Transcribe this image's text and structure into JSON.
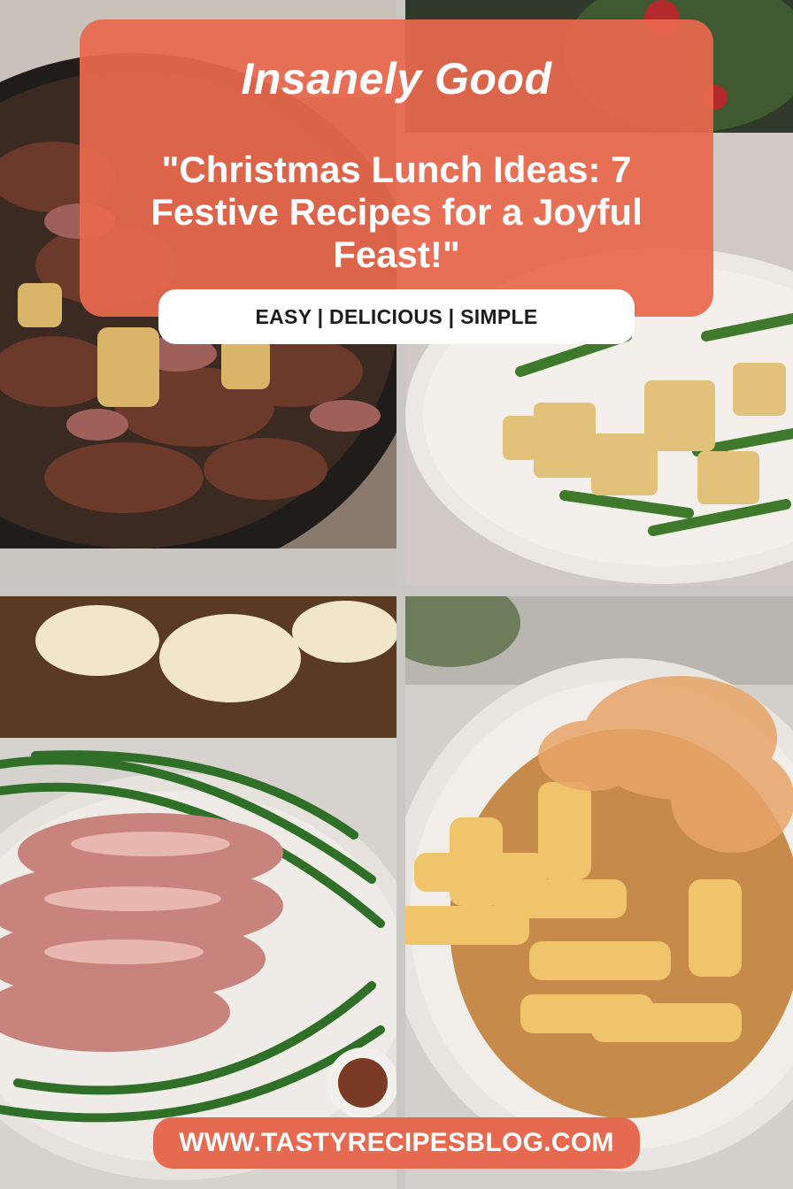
{
  "header": {
    "brand": "Insanely Good",
    "headline": "\"Christmas Lunch Ideas: 7 Festive Recipes for a Joyful Feast!\"",
    "tagline": "EASY | DELICIOUS | SIMPLE"
  },
  "footer": {
    "url": "WWW.TASTYRECIPESBLOG.COM"
  },
  "photos": [
    {
      "id": "photo-roast-skillet",
      "depicts": "sliced roast meat with potatoes in cast-iron skillet"
    },
    {
      "id": "photo-potatoes-green-beans",
      "depicts": "roasted potato cubes with green beans on plate"
    },
    {
      "id": "photo-ham-green-beans",
      "depicts": "sliced ham with green beans on platter"
    },
    {
      "id": "photo-rigatoni",
      "depicts": "rigatoni pasta with cheese crumb topping"
    }
  ],
  "colors": {
    "accent": "#e8684e",
    "pill": "#ffffff",
    "text_light": "#ffffff",
    "text_dark": "#1d1d1d"
  }
}
